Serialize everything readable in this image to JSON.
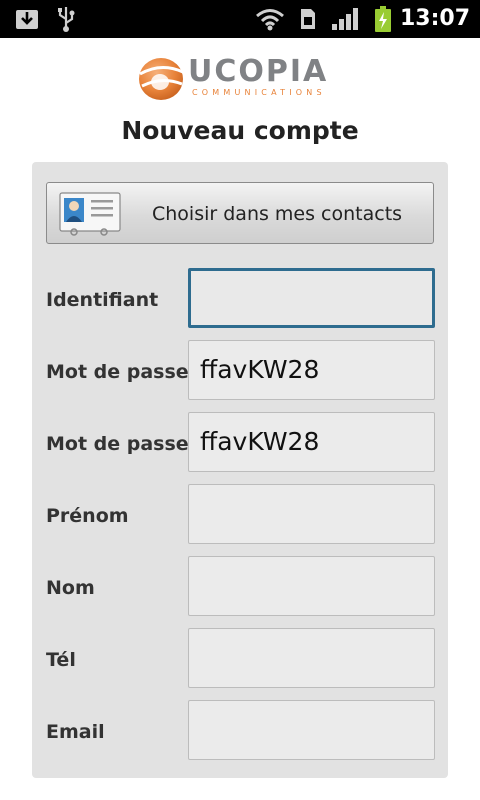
{
  "status_bar": {
    "time": "13:07",
    "icons": [
      "download-icon",
      "usb-icon",
      "wifi-icon",
      "sim-icon",
      "signal-icon",
      "battery-charging-icon"
    ]
  },
  "logo": {
    "name": "UCOPIA",
    "tagline": "COMMUNICATIONS",
    "colors": {
      "orange": "#e8833a",
      "gray": "#808285"
    }
  },
  "title": "Nouveau compte",
  "contacts_button": {
    "label": "Choisir dans mes contacts",
    "icon": "contact-card-icon"
  },
  "form": {
    "fields": [
      {
        "label": "Identifiant",
        "value": "",
        "focused": true
      },
      {
        "label": "Mot de passe",
        "value": "ffavKW28"
      },
      {
        "label": "Mot de passe",
        "value": "ffavKW28"
      },
      {
        "label": "Prénom",
        "value": ""
      },
      {
        "label": "Nom",
        "value": ""
      },
      {
        "label": "Tél",
        "value": ""
      },
      {
        "label": "Email",
        "value": ""
      }
    ]
  },
  "colors": {
    "focus": "#2e6c8f",
    "panel": "#e2e2e2",
    "field": "#ebebeb"
  }
}
